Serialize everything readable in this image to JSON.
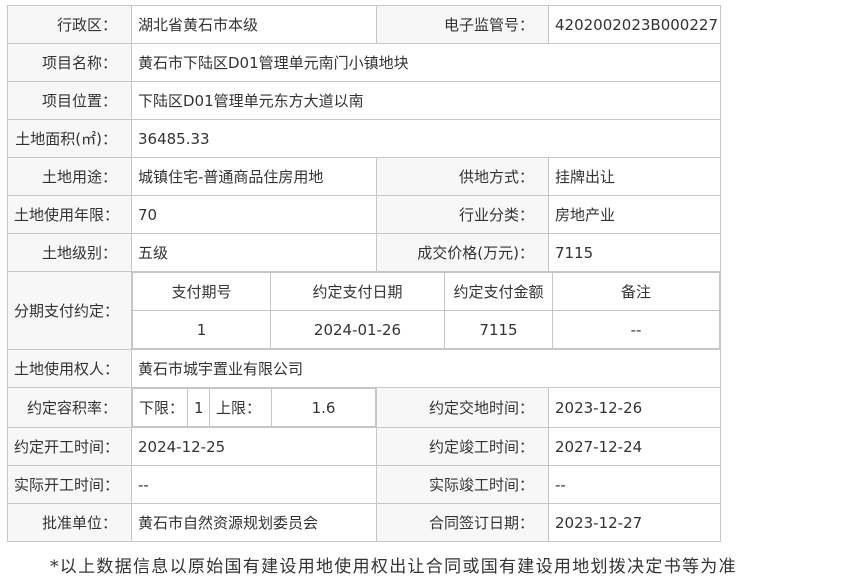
{
  "district": {
    "label": "行政区：",
    "value": "湖北省黄石市本级"
  },
  "supervision_no": {
    "label": "电子监管号：",
    "value": "4202002023B000227"
  },
  "project_name": {
    "label": "项目名称：",
    "value": "黄石市下陆区D01管理单元南门小镇地块"
  },
  "project_location": {
    "label": "项目位置：",
    "value": "下陆区D01管理单元东方大道以南"
  },
  "land_area": {
    "label": "土地面积(㎡)：",
    "value": "36485.33"
  },
  "land_use": {
    "label": "土地用途：",
    "value": "城镇住宅-普通商品住房用地"
  },
  "supply_method": {
    "label": "供地方式：",
    "value": "挂牌出让"
  },
  "use_term": {
    "label": "土地使用年限：",
    "value": "70"
  },
  "industry": {
    "label": "行业分类：",
    "value": "房地产业"
  },
  "land_grade": {
    "label": "土地级别：",
    "value": "五级"
  },
  "deal_price": {
    "label": "成交价格(万元)：",
    "value": "7115"
  },
  "installments": {
    "label": "分期支付约定：",
    "headers": [
      "支付期号",
      "约定支付日期",
      "约定支付金额",
      "备注"
    ],
    "rows": [
      [
        "1",
        "2024-01-26",
        "7115",
        "--"
      ]
    ]
  },
  "right_holder": {
    "label": "土地使用权人：",
    "value": "黄石市城宇置业有限公司"
  },
  "plot_ratio": {
    "label": "约定容积率：",
    "lower_label": "下限：",
    "lower_value": "1",
    "upper_label": "上限：",
    "upper_value": "1.6"
  },
  "handover_time": {
    "label": "约定交地时间：",
    "value": "2023-12-26"
  },
  "start_time": {
    "label": "约定开工时间：",
    "value": "2024-12-25"
  },
  "completion_time": {
    "label": "约定竣工时间：",
    "value": "2027-12-24"
  },
  "actual_start": {
    "label": "实际开工时间：",
    "value": "--"
  },
  "actual_completion": {
    "label": "实际竣工时间：",
    "value": "--"
  },
  "approval_unit": {
    "label": "批准单位：",
    "value": "黄石市自然资源规划委员会"
  },
  "contract_date": {
    "label": "合同签订日期：",
    "value": "2023-12-27"
  },
  "footnote": "*以上数据信息以原始国有建设用地使用权出让合同或国有建设用地划拨决定书等为准"
}
